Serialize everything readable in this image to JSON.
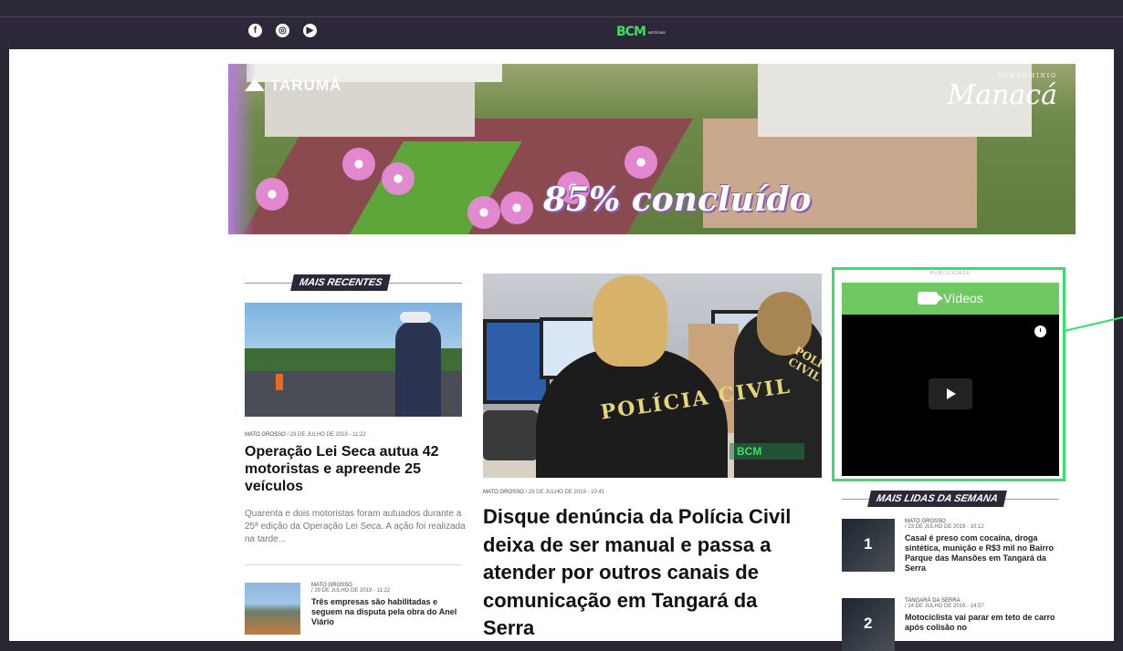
{
  "header": {
    "social": [
      {
        "icon": "facebook-icon",
        "glyph": "f"
      },
      {
        "icon": "instagram-icon",
        "glyph": "◎"
      },
      {
        "icon": "youtube-icon",
        "glyph": "▶"
      }
    ],
    "logo_text": "BCM",
    "logo_sub": "NOTÍCIAS"
  },
  "banner": {
    "brand_left": "TARUMÃ",
    "brand_right": "Manacá",
    "brand_right_small": "CONDOMÍNIO",
    "percent_text": "85% concluído"
  },
  "recentes": {
    "heading": "MAIS RECENTES",
    "featured": {
      "category": "MATO GROSSO",
      "date": "/ 29 de julho de 2019 - 11:22",
      "title": "Operação Lei Seca autua 42 motoristas e apreende 25 veículos",
      "excerpt": "Quarenta e dois motoristas foram autuados durante a 25ª edição da Operação Lei Seca. A ação foi realizada na tarde..."
    },
    "item2": {
      "category": "MATO GROSSO",
      "date": "/ 29 de julho de 2019 - 11:22",
      "title": "Três empresas são habilitadas e seguem na disputa pela obra do Anel Viário"
    }
  },
  "main_story": {
    "photo_text": "POLÍCIA CIVIL",
    "photo_text2": "POLÍCIA CIVIL",
    "category": "MATO GROSSO",
    "date": "/ 29 de julho de 2019 - 10:41",
    "title": "Disque denúncia da Polícia Civil deixa de ser manual e passa a atender por outros canais de comunicação em Tangará da Serra"
  },
  "sidebar": {
    "ad_label": "PUBLICIDADE",
    "video_title": "Vídeos",
    "lidas_heading": "MAIS LIDAS DA SEMANA",
    "lidas": [
      {
        "rank": "1",
        "category": "MATO GROSSO",
        "date": "/ 23 de julho de 2019 - 10:12",
        "title": "Casal é preso com cocaína, droga sintética, munição e R$3 mil no Bairro Parque das Mansões em Tangará da Serra"
      },
      {
        "rank": "2",
        "category": "TANGARÁ DA SERRA",
        "date": "/ 24 de julho de 2019 - 14:57",
        "title": "Motociclista vai parar em teto de carro após colisão no"
      }
    ]
  },
  "colors": {
    "accent_green": "#37e06a",
    "header_bg": "#2d2838"
  }
}
